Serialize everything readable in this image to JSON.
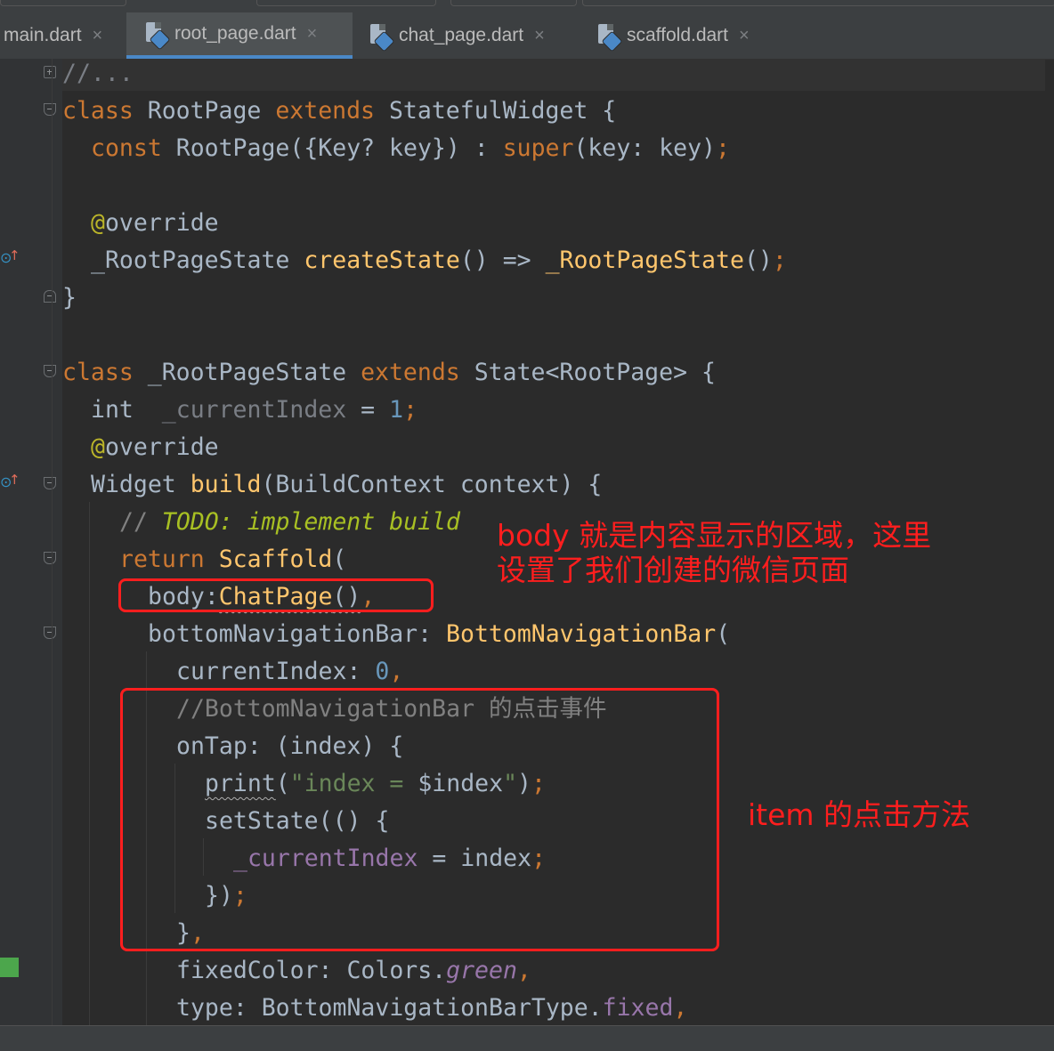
{
  "tabs": [
    {
      "name": "main.dart",
      "active": false
    },
    {
      "name": "root_page.dart",
      "active": true
    },
    {
      "name": "chat_page.dart",
      "active": false
    },
    {
      "name": "scaffold.dart",
      "active": false
    }
  ],
  "close_glyph": "×",
  "code": {
    "l1": "//...",
    "l2": {
      "k1": "class",
      "t1": " RootPage ",
      "k2": "extends",
      "t2": " StatefulWidget {"
    },
    "l3": {
      "k1": "const",
      "t1": " RootPage({Key? key}) : ",
      "k2": "super",
      "t2": "(key: key)",
      "k3": ";"
    },
    "l5": {
      "a": "@",
      "t": "override"
    },
    "l6": {
      "t1": "_RootPageState ",
      "f1": "createState",
      "t2": "() => ",
      "f2": "_RootPageState",
      "t3": "()",
      "k": ";"
    },
    "l7": "}",
    "l9": {
      "k1": "class",
      "t1": " _RootPageState ",
      "k2": "extends",
      "t2": " State<RootPage> {"
    },
    "l10": {
      "k1": "int",
      "f": "  _currentIndex",
      "t1": " = ",
      "n": "1",
      "k2": ";"
    },
    "l11": {
      "a": "@",
      "t": "override"
    },
    "l12": {
      "t1": "Widget ",
      "f": "build",
      "t2": "(BuildContext context) {"
    },
    "l13": {
      "c": "// ",
      "todo": "TODO: implement build"
    },
    "l14": {
      "k": "return",
      "t1": " ",
      "f": "Scaffold",
      "t2": "("
    },
    "l15": {
      "t1": "body:",
      "f": "ChatPage",
      "t2": "()",
      "k": ","
    },
    "l16": {
      "t1": "bottomNavigationBar: ",
      "f": "BottomNavigationBar",
      "t2": "("
    },
    "l17": {
      "t1": "currentIndex: ",
      "n": "0",
      "k": ","
    },
    "l18": "//BottomNavigationBar 的点击事件",
    "l19": "onTap: (index) {",
    "l20": {
      "t1": "print",
      "t2": "(",
      "s": "\"index = ",
      "v": "$index",
      "s2": "\"",
      "t3": ")",
      "k": ";"
    },
    "l21": "setState(() {",
    "l22": {
      "f": "_currentIndex",
      "t": " = index",
      "k": ";"
    },
    "l23": {
      "t": "})",
      "k": ";"
    },
    "l24": {
      "t": "}",
      "k": ","
    },
    "l25": {
      "t1": "fixedColor: Colors.",
      "f": "green",
      "k": ","
    },
    "l26": {
      "t1": "type: BottomNavigationBarType.",
      "f": "fixed",
      "k": ","
    }
  },
  "annotations": {
    "body_note_line1": "body 就是内容显示的区域，这里",
    "body_note_line2": "设置了我们创建的微信页面",
    "item_note": "item 的点击方法"
  },
  "colors": {
    "background": "#2b2b2b",
    "keyword": "#cc7832",
    "function": "#ffc66d",
    "annotation_red": "#ff1e1e"
  }
}
